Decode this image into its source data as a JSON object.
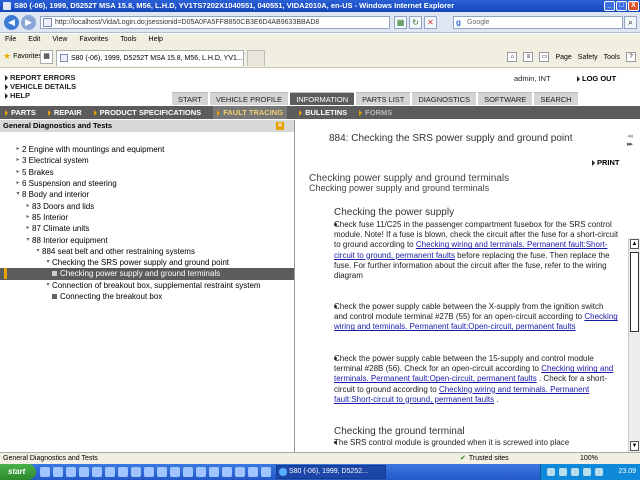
{
  "window": {
    "title": "S80 (-06), 1999, D5252T MSA 15.8, M56, L.H.D, YV1TS7202X1040551, 040551, VIDA2010A, en-US - Windows Internet Explorer",
    "controls": [
      "_",
      "□",
      "X"
    ]
  },
  "browser": {
    "url": "http://localhost/Vida/Login.do;jsessionid=D05A0FA5FFB850CB3E6D4AB9633BBAD8",
    "search_placeholder": "Google",
    "menu": [
      "File",
      "Edit",
      "View",
      "Favorites",
      "Tools",
      "Help"
    ],
    "favorites_label": "Favorites",
    "tab_label": "S80 (-06), 1999, D5252T MSA 15.8, M56, L.H.D, YV1...",
    "commands": [
      "Page",
      "Safety",
      "Tools"
    ]
  },
  "vida": {
    "top_links": [
      "REPORT ERRORS",
      "VEHICLE DETAILS",
      "HELP"
    ],
    "user": "admin, INT",
    "logout": "LOG OUT",
    "main_tabs": [
      "START",
      "VEHICLE PROFILE",
      "INFORMATION",
      "PARTS LIST",
      "DIAGNOSTICS",
      "SOFTWARE",
      "SEARCH"
    ],
    "active_tab": "INFORMATION",
    "sub_nav": [
      "PARTS",
      "REPAIR",
      "PRODUCT SPECIFICATIONS",
      "FAULT TRACING",
      "BULLETINS",
      "FORMS"
    ],
    "left_pane": {
      "title": "General Diagnostics and Tests",
      "tree": [
        {
          "label": "2 Engine with mountings and equipment",
          "toggle": "▸"
        },
        {
          "label": "3 Electrical system",
          "toggle": "▸"
        },
        {
          "label": "5 Brakes",
          "toggle": "▸"
        },
        {
          "label": "6 Suspension and steering",
          "toggle": "▸"
        },
        {
          "label": "8 Body and interior",
          "toggle": "▾"
        },
        {
          "label": "83 Doors and lids",
          "toggle": "▸"
        },
        {
          "label": "85 Interior",
          "toggle": "▸"
        },
        {
          "label": "87 Climate units",
          "toggle": "▸"
        },
        {
          "label": "88 Interior equipment",
          "toggle": "▾"
        },
        {
          "label": "884 seat belt and other restraining systems",
          "toggle": "▾"
        },
        {
          "label": "Checking the SRS power supply and ground point",
          "toggle": "▾"
        },
        {
          "label": "Checking power supply and ground terminals",
          "toggle": ""
        },
        {
          "label": "Connection of breakout box, supplemental restraint system",
          "toggle": "▾"
        },
        {
          "label": "Connecting the breakout box",
          "toggle": ""
        }
      ]
    },
    "right_pane": {
      "title": "884: Checking the SRS power supply and ground point",
      "print": "PRINT",
      "heading_main": "Checking power supply and ground terminals",
      "heading_sub": "Checking power supply and ground terminals",
      "section1": "Checking the power supply",
      "items": [
        {
          "pre": "Check fuse 11/C25 in the passenger compartment fusebox for the SRS control module. Note! If a fuse is blown, check the circuit after the fuse for a short-circuit to ground according to ",
          "link1": "Checking wiring and terminals. Permanent fault:Short-circuit to ground, permanent faults",
          "mid": " before replacing the fuse. Then replace the fuse. For further information about the circuit after the fuse, refer to the wiring diagram",
          "link2": "",
          "post": ""
        },
        {
          "pre": "Check the power supply cable between the X-supply from the ignition switch and control module terminal #27B (55) for an open-circuit according to ",
          "link1": "Checking wiring and terminals. Permanent fault:Open-circuit, permanent faults",
          "mid": "",
          "link2": "",
          "post": ""
        },
        {
          "pre": "Check the power supply cable between the 15-supply and control module terminal #28B (56). Check for an open-circuit according to ",
          "link1": "Checking wiring and terminals. Permanent fault:Open-circuit, permanent faults",
          "mid": " . Check for a short-circuit to ground according to ",
          "link2": "Checking wiring and terminals. Permanent fault:Short-circuit to ground, permanent faults",
          "post": " ."
        }
      ],
      "section2": "Checking the ground terminal",
      "section2_text": "The SRS control module is grounded when it is screwed into place"
    }
  },
  "status": {
    "text": "General Diagnostics and Tests",
    "zone": "Trusted sites",
    "zoom": "100%"
  },
  "taskbar": {
    "start": "start",
    "task": "S80 (-06), 1999, D5252...",
    "clock": "23.09"
  }
}
